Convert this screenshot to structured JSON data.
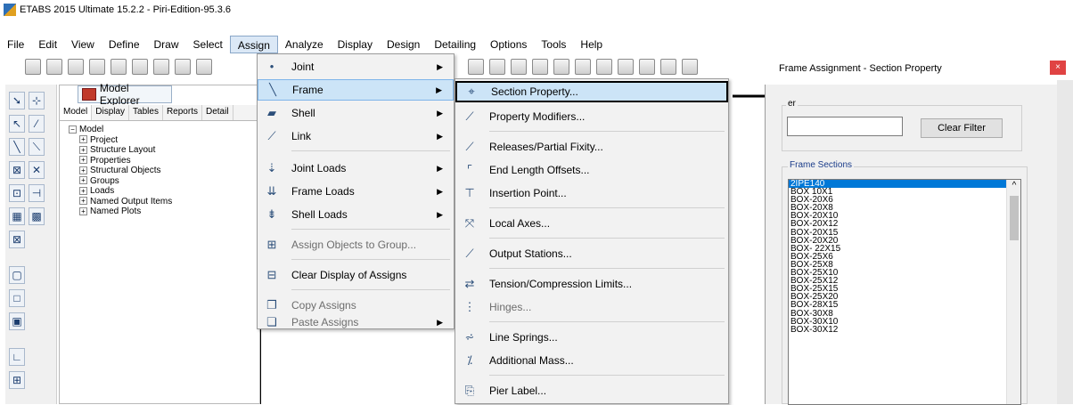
{
  "window": {
    "title": "ETABS 2015 Ultimate 15.2.2 - Piri-Edition-95.3.6"
  },
  "menubar": {
    "items": [
      "File",
      "Edit",
      "View",
      "Define",
      "Draw",
      "Select",
      "Assign",
      "Analyze",
      "Display",
      "Design",
      "Detailing",
      "Options",
      "Tools",
      "Help"
    ],
    "active": "Assign"
  },
  "explorer": {
    "title": "Model Explorer",
    "tabs": [
      "Model",
      "Display",
      "Tables",
      "Reports",
      "Detail"
    ],
    "tree": {
      "root": "Model",
      "children": [
        "Project",
        "Structure Layout",
        "Properties",
        "Structural Objects",
        "Groups",
        "Loads",
        "Named Output Items",
        "Named Plots"
      ]
    }
  },
  "assign_menu": {
    "items": [
      {
        "label": "Joint",
        "submenu": true,
        "icon": "joint-icon"
      },
      {
        "label": "Frame",
        "submenu": true,
        "icon": "frame-icon",
        "highlighted": true
      },
      {
        "label": "Shell",
        "submenu": true,
        "icon": "shell-icon"
      },
      {
        "label": "Link",
        "submenu": true,
        "icon": "link-icon"
      },
      {
        "label": "Joint Loads",
        "submenu": true,
        "icon": "joint-loads-icon"
      },
      {
        "label": "Frame Loads",
        "submenu": true,
        "icon": "frame-loads-icon"
      },
      {
        "label": "Shell Loads",
        "submenu": true,
        "icon": "shell-loads-icon"
      },
      {
        "label": "Assign Objects to Group...",
        "icon": "group-icon",
        "disabled": true
      },
      {
        "label": "Clear Display of Assigns",
        "icon": "clear-display-icon"
      },
      {
        "label": "Copy Assigns",
        "icon": "copy-icon",
        "disabled": true
      },
      {
        "label": "Paste Assigns",
        "submenu": true,
        "icon": "paste-icon",
        "disabled": true
      }
    ]
  },
  "frame_menu": {
    "items": [
      {
        "label": "Section Property...",
        "icon": "section-property-icon",
        "highlighted": true
      },
      {
        "label": "Property Modifiers...",
        "icon": "property-modifiers-icon"
      },
      {
        "label": "Releases/Partial Fixity...",
        "icon": "releases-icon"
      },
      {
        "label": "End Length Offsets...",
        "icon": "end-offsets-icon"
      },
      {
        "label": "Insertion Point...",
        "icon": "insertion-point-icon"
      },
      {
        "label": "Local Axes...",
        "icon": "local-axes-icon"
      },
      {
        "label": "Output Stations...",
        "icon": "output-stations-icon"
      },
      {
        "label": "Tension/Compression Limits...",
        "icon": "tension-compression-icon"
      },
      {
        "label": "Hinges...",
        "icon": "hinges-icon",
        "disabled": true
      },
      {
        "label": "Line Springs...",
        "icon": "line-springs-icon"
      },
      {
        "label": "Additional Mass...",
        "icon": "additional-mass-icon"
      },
      {
        "label": "Pier Label...",
        "icon": "pier-label-icon"
      }
    ]
  },
  "dialog": {
    "title": "Frame Assignment - Section Property",
    "close": "×",
    "filter": {
      "caption": "er",
      "value": "",
      "button": "Clear Filter"
    },
    "sections": {
      "caption": "Frame Sections",
      "items": [
        "2IPE140",
        "BOX 10X1",
        "BOX-20X6",
        "BOX-20X8",
        "BOX-20X10",
        "BOX-20X12",
        "BOX-20X15",
        "BOX-20X20",
        "BOX- 22X15",
        "BOX-25X6",
        "BOX-25X8",
        "BOX-25X10",
        "BOX-25X12",
        "BOX-25X15",
        "BOX-25X20",
        "BOX-28X15",
        "BOX-30X8",
        "BOX-30X10",
        "BOX-30X12"
      ],
      "selected": "2IPE140"
    }
  },
  "colors": {
    "highlight": "#cce4f7",
    "selection": "#0078d7",
    "close": "#e04343"
  }
}
